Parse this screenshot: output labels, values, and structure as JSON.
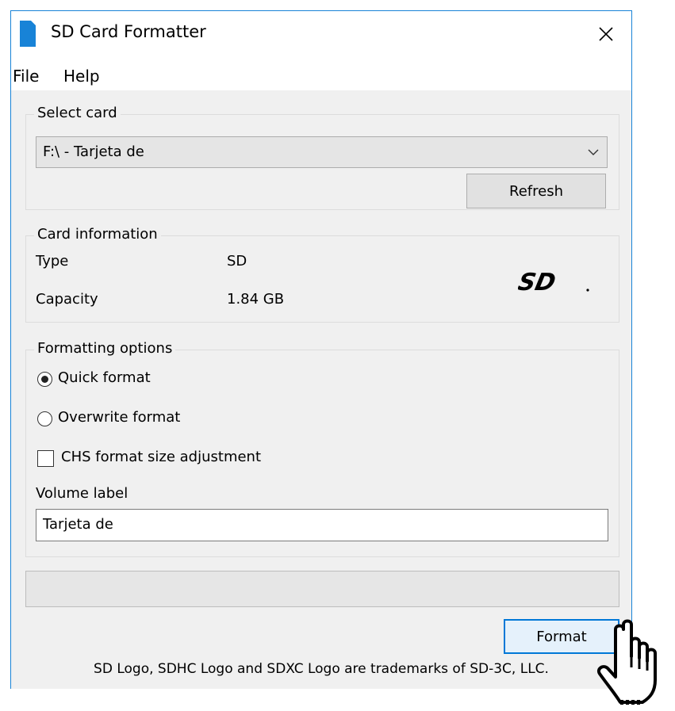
{
  "window": {
    "title": "SD Card Formatter"
  },
  "menu": {
    "items": [
      "File",
      "Help"
    ]
  },
  "select_card": {
    "legend": "Select card",
    "selected": "F:\\ - Tarjeta de",
    "refresh_label": "Refresh"
  },
  "card_info": {
    "legend": "Card information",
    "type_label": "Type",
    "type_value": "SD",
    "capacity_label": "Capacity",
    "capacity_value": "1.84 GB",
    "logo_text": "SD"
  },
  "formatting": {
    "legend": "Formatting options",
    "quick_label": "Quick format",
    "quick_checked": true,
    "overwrite_label": "Overwrite format",
    "overwrite_checked": false,
    "chs_label": "CHS format size adjustment",
    "chs_checked": false,
    "volume_label_caption": "Volume label",
    "volume_label_value": "Tarjeta de"
  },
  "progress": {
    "fraction": 0
  },
  "format_label": "Format",
  "footer_text": "SD Logo, SDHC Logo and SDXC Logo are trademarks of SD-3C, LLC.",
  "colors": {
    "accent": "#1883d7",
    "window_bg": "#f0f0f0"
  },
  "icons": {
    "app": "sd-card-icon",
    "close": "close-icon",
    "dropdown": "chevron-down-icon",
    "cursor": "hand-pointer-icon"
  }
}
